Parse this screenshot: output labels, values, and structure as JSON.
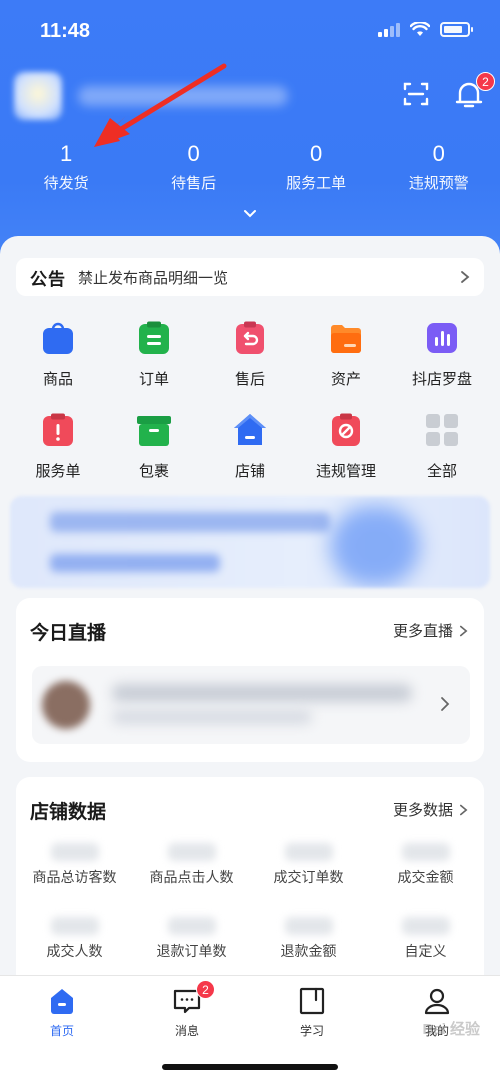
{
  "status_bar": {
    "time": "11:48"
  },
  "header": {
    "notification_badge": "2"
  },
  "stats": [
    {
      "value": "1",
      "label": "待发货"
    },
    {
      "value": "0",
      "label": "待售后"
    },
    {
      "value": "0",
      "label": "服务工单"
    },
    {
      "value": "0",
      "label": "违规预警"
    }
  ],
  "notice": {
    "tag": "公告",
    "text": "禁止发布商品明细一览"
  },
  "quick_entries": [
    {
      "label": "商品",
      "icon": "bag-icon",
      "color": "#2f6bf2"
    },
    {
      "label": "订单",
      "icon": "clipboard-icon",
      "color": "#22b24c"
    },
    {
      "label": "售后",
      "icon": "return-icon",
      "color": "#f0506e"
    },
    {
      "label": "资产",
      "icon": "folder-icon",
      "color": "#ff7a1a"
    },
    {
      "label": "抖店罗盘",
      "icon": "bar-chart-icon",
      "color": "#7b5cf5"
    },
    {
      "label": "服务单",
      "icon": "alert-icon",
      "color": "#f04a5a"
    },
    {
      "label": "包裹",
      "icon": "box-icon",
      "color": "#22b24c"
    },
    {
      "label": "店铺",
      "icon": "store-icon",
      "color": "#2f6bf2"
    },
    {
      "label": "违规管理",
      "icon": "ban-icon",
      "color": "#f04a5a"
    },
    {
      "label": "全部",
      "icon": "grid-icon",
      "color": "#c9cdd3"
    }
  ],
  "live": {
    "title": "今日直播",
    "more": "更多直播"
  },
  "store_data": {
    "title": "店铺数据",
    "more": "更多数据",
    "metrics": [
      "商品总访客数",
      "商品点击人数",
      "成交订单数",
      "成交金额",
      "成交人数",
      "退款订单数",
      "退款金额",
      "自定义"
    ]
  },
  "tabbar": {
    "tabs": [
      {
        "label": "首页",
        "icon": "home-icon",
        "active": true
      },
      {
        "label": "消息",
        "icon": "message-icon",
        "badge": "2"
      },
      {
        "label": "学习",
        "icon": "book-icon"
      },
      {
        "label": "我的",
        "icon": "user-icon"
      }
    ]
  },
  "watermark": "Bai 经验",
  "colors": {
    "brand": "#3d7bf7",
    "badge": "#f5384a",
    "active_tab": "#2f6bf2"
  }
}
